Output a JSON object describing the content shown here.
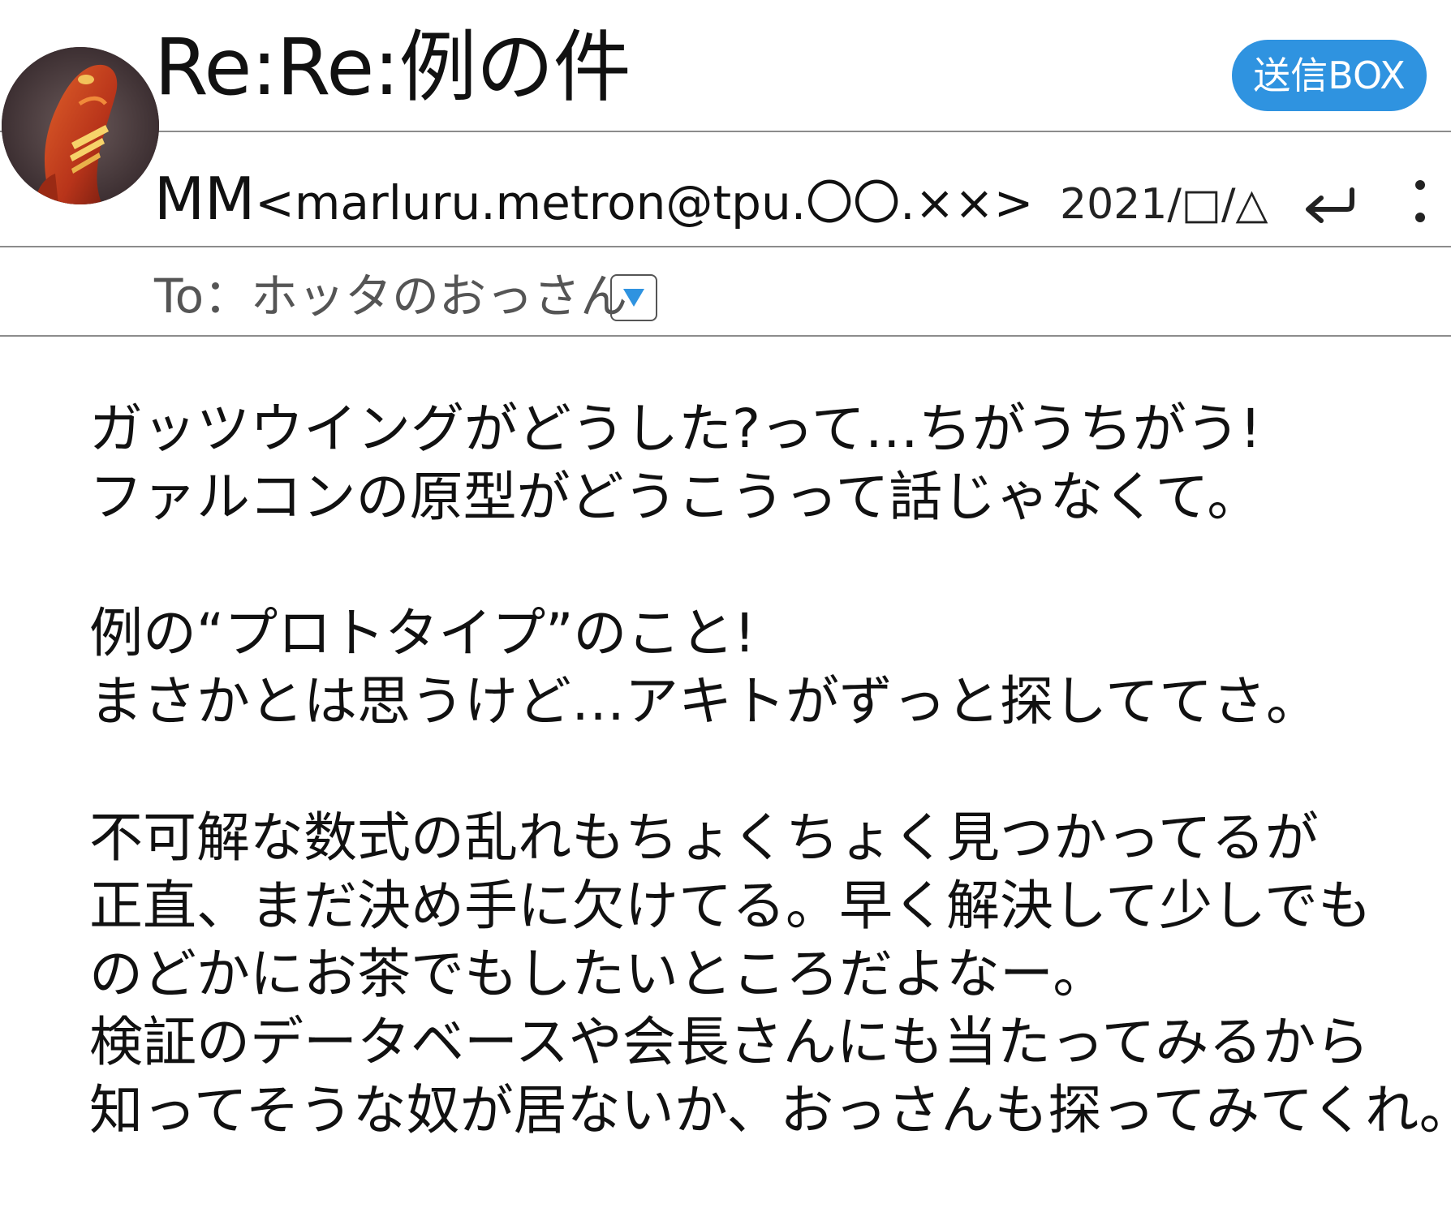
{
  "header": {
    "subject": "Re:Re:例の件",
    "folder_button": "送信BOX"
  },
  "sender": {
    "name": "MM",
    "address": "<marluru.metron@tpu.〇〇.××>",
    "date": "2021/□/△",
    "avatar_icon": "sender-avatar-photo",
    "reply_icon": "reply-arrow-icon",
    "menu_icon": "vertical-ellipsis-icon"
  },
  "recipient": {
    "to": "To：ホッタのおっさん",
    "expand_icon": "triangle-down-icon"
  },
  "body": {
    "paragraphs": [
      [
        "ガッツウイングがどうした?って…ちがうちがう!",
        "ファルコンの原型がどうこうって話じゃなくて。"
      ],
      [
        "例の“プロトタイプ”のこと!",
        "まさかとは思うけど…アキトがずっと探しててさ。"
      ],
      [
        "不可解な数式の乱れもちょくちょく見つかってるが",
        "正直、まだ決め手に欠けてる。早く解決して少しでも",
        "のどかにお茶でもしたいところだよなー。",
        "検証のデータベースや会長さんにも当たってみるから",
        "知ってそうな奴が居ないか、おっさんも探ってみてくれ。"
      ]
    ]
  },
  "colors": {
    "accent": "#2f93e0",
    "divider": "#8c8c8c",
    "text": "#111111",
    "muted": "#555555"
  }
}
